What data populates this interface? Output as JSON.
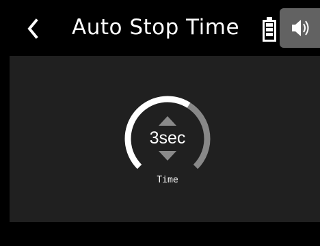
{
  "header": {
    "title": "Auto Stop Time"
  },
  "setting": {
    "value": "3sec",
    "label": "Time",
    "level_fraction": 0.62
  },
  "icons": {
    "back": "chevron-left-icon",
    "battery": "battery-icon",
    "speaker": "speaker-icon",
    "increment": "triangle-up-icon",
    "decrement": "triangle-down-icon"
  },
  "colors": {
    "background": "#000000",
    "panel": "#202020",
    "dial_active": "#ffffff",
    "dial_inactive": "#888888",
    "arrows": "#8a8a8a",
    "speaker_button": "#626262"
  }
}
